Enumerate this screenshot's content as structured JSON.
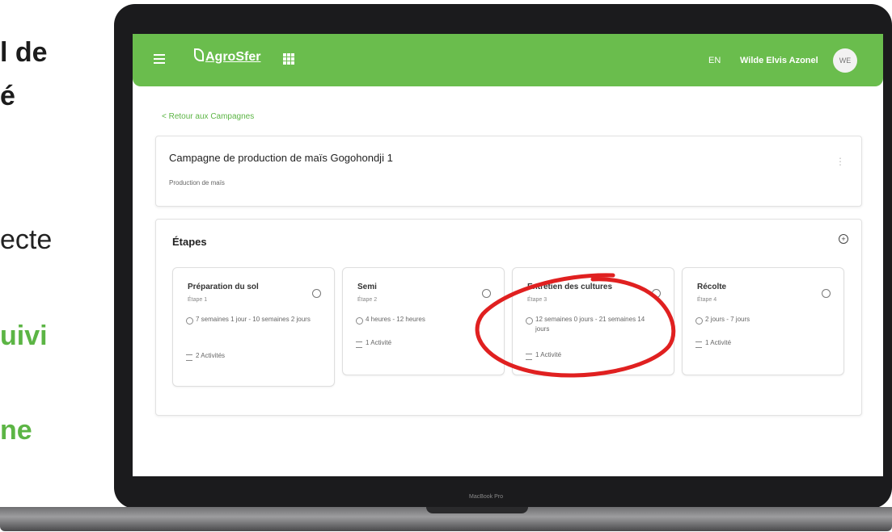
{
  "side_text": {
    "line1": "l de",
    "line2": "é",
    "line3": "ecte",
    "line4": "uivi",
    "line5": "ne"
  },
  "laptop": {
    "label": "MacBook Pro"
  },
  "topbar": {
    "logo": "AgroSfer",
    "lang": "EN",
    "user": "Wilde Elvis Azonel",
    "avatar": "WE"
  },
  "back_link": "< Retour aux Campagnes",
  "campaign": {
    "title": "Campagne de production de maïs Gogohondji 1",
    "subtitle": "Production de maïs"
  },
  "steps": {
    "title": "Étapes",
    "items": [
      {
        "name": "Préparation du sol",
        "order": "Étape 1",
        "duration": "7 semaines 1 jour - 10 semaines 2 jours",
        "activities": "2 Activités"
      },
      {
        "name": "Semi",
        "order": "Étape 2",
        "duration": "4 heures - 12 heures",
        "activities": "1 Activité"
      },
      {
        "name": "Entretien des cultures",
        "order": "Étape 3",
        "duration": "12 semaines 0 jours - 21 semaines 14 jours",
        "activities": "1 Activité"
      },
      {
        "name": "Récolte",
        "order": "Étape 4",
        "duration": "2 jours - 7 jours",
        "activities": "1 Activité"
      }
    ]
  },
  "colors": {
    "brand_green": "#6abd4d",
    "annotation_red": "#e02020"
  }
}
